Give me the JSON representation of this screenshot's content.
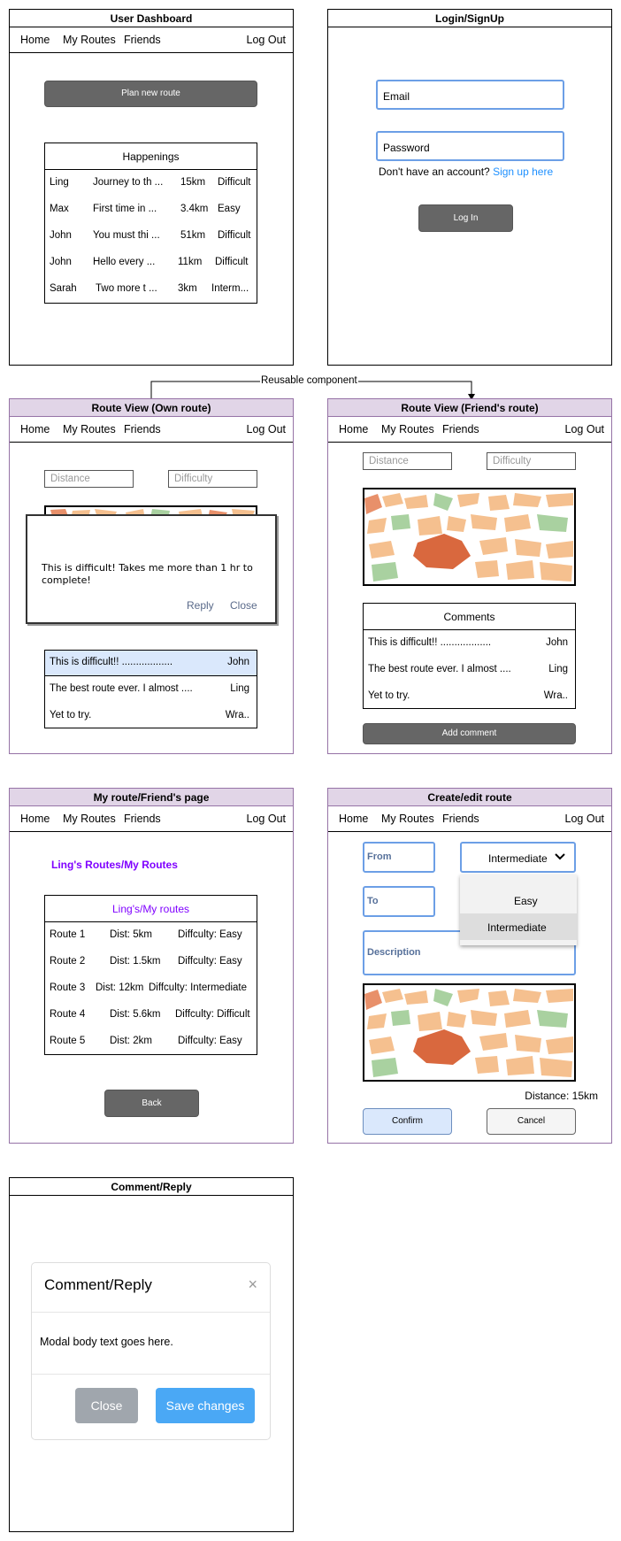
{
  "dashboard": {
    "title": "User Dashboard",
    "nav": [
      "Home",
      "My Routes",
      "Friends",
      "Log Out"
    ],
    "plan_button": "Plan new route",
    "happenings": {
      "header": "Happenings",
      "rows": [
        [
          "Ling",
          "Journey to th ...",
          "15km",
          "Difficult"
        ],
        [
          "Max",
          "First time in ...",
          "3.4km",
          "Easy"
        ],
        [
          "John",
          "You must thi ...",
          "51km",
          "Difficult"
        ],
        [
          "John",
          "Hello every  ...",
          "11km",
          "Difficult"
        ],
        [
          "Sarah",
          "Two more t ...",
          "3km",
          "Interm..."
        ]
      ]
    }
  },
  "login": {
    "title": "Login/SignUp",
    "email_placeholder": "Email",
    "password_placeholder": "Password",
    "no_account_text": "Don't have an account?",
    "signup_link": "Sign up here",
    "login_button": "Log In",
    "link_color": "#1e90ff"
  },
  "connector": {
    "label": "Reusable component"
  },
  "route_own": {
    "title": "Route View (Own route)",
    "nav": [
      "Home",
      "My Routes",
      "Friends",
      "Log Out"
    ],
    "distance_placeholder": "Distance",
    "difficulty_placeholder": "Difficulty",
    "popup": {
      "text": "This is difficult! Takes me more than 1 hr to complete!",
      "reply": "Reply",
      "close": "Close"
    },
    "comments": [
      [
        "This is  difficult!! ..................",
        "John"
      ],
      [
        "The best route ever. I almost ....",
        "Ling"
      ],
      [
        "Yet to try.",
        "Wra.."
      ]
    ],
    "selected_row_color": "#dae8fc"
  },
  "route_friend": {
    "title": "Route View (Friend's route)",
    "nav": [
      "Home",
      "My Routes",
      "Friends",
      "Log Out"
    ],
    "distance_placeholder": "Distance",
    "difficulty_placeholder": "Difficulty",
    "comments_header": "Comments",
    "comments": [
      [
        "This is  difficult!! ..................",
        "John"
      ],
      [
        "The best route ever. I almost ....",
        "Ling"
      ],
      [
        "Yet to try.",
        "Wra.."
      ]
    ],
    "add_comment_button": "Add comment"
  },
  "my_routes": {
    "title": "My route/Friend's page",
    "nav": [
      "Home",
      "My Routes",
      "Friends",
      "Log Out"
    ],
    "heading": "Ling's Routes/My Routes",
    "table_header": "Ling's/My routes",
    "rows": [
      [
        "Route 1",
        "Dist: 5km",
        "Diffculty: Easy"
      ],
      [
        "Route 2",
        "Dist: 1.5km",
        "Diffculty: Easy"
      ],
      [
        "Route 3",
        "Dist: 12km",
        "Diffculty: Intermediate"
      ],
      [
        "Route 4",
        "Dist: 5.6km",
        "Diffculty: Difficult"
      ],
      [
        "Route 5",
        "Dist: 2km",
        "Diffculty: Easy"
      ]
    ],
    "back_button": "Back",
    "accent_color": "#7f00ff"
  },
  "create_route": {
    "title": "Create/edit route",
    "nav": [
      "Home",
      "My Routes",
      "Friends",
      "Log Out"
    ],
    "from_label": "From",
    "to_label": "To",
    "description_label": "Description",
    "difficulty_selected": "Intermediate",
    "dropdown_options": [
      "Easy",
      "Intermediate"
    ],
    "distance_text": "Distance: 15km",
    "confirm_button": "Confirm",
    "cancel_button": "Cancel"
  },
  "comment_reply": {
    "title": "Comment/Reply",
    "modal_title": "Comment/Reply",
    "modal_close_glyph": "×",
    "modal_body": "Modal body text goes here.",
    "close_button": "Close",
    "save_button": "Save changes",
    "close_button_color": "#a0a6ad",
    "save_button_color": "#4aa8f5"
  }
}
